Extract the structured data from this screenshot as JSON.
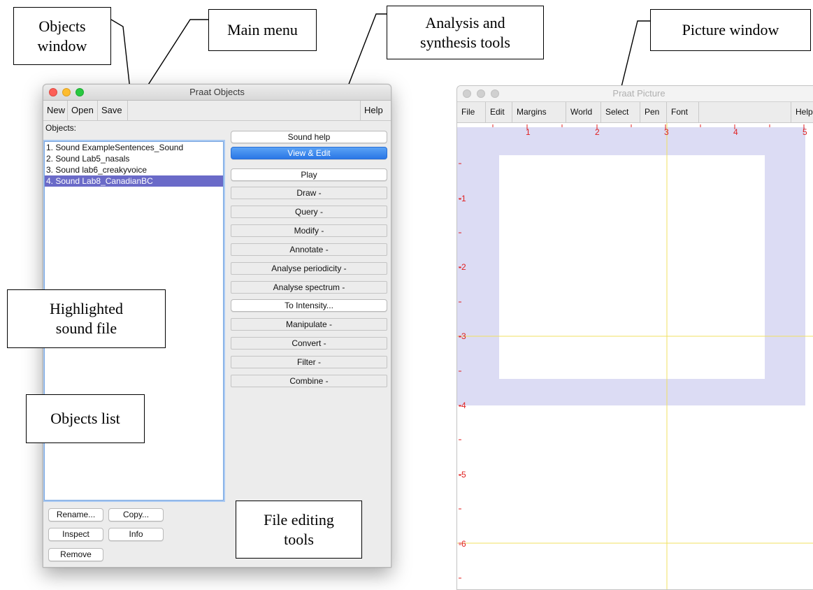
{
  "callouts": {
    "objects_window": "Objects\nwindow",
    "main_menu": "Main menu",
    "analysis_tools": "Analysis and\nsynthesis tools",
    "picture_window": "Picture window",
    "highlighted_sound": "Highlighted\nsound file",
    "objects_list": "Objects list",
    "file_editing": "File editing\ntools"
  },
  "objects_window": {
    "title": "Praat Objects",
    "menu": [
      "New",
      "Open",
      "Save"
    ],
    "help": "Help",
    "objects_label": "Objects:",
    "objects": [
      "1. Sound ExampleSentences_Sound",
      "2. Sound Lab5_nasals",
      "3. Sound lab6_creakyvoice",
      "4. Sound Lab8_CanadianBC"
    ],
    "selected_index": 3,
    "actions": [
      "Sound help",
      "View & Edit",
      "Play",
      "Draw -",
      "Query -",
      "Modify -",
      "Annotate -",
      "Analyse periodicity -",
      "Analyse spectrum -",
      "To Intensity...",
      "Manipulate -",
      "Convert -",
      "Filter -",
      "Combine -"
    ],
    "file_buttons": {
      "rename": "Rename...",
      "copy": "Copy...",
      "inspect": "Inspect",
      "info": "Info",
      "remove": "Remove"
    },
    "colors": {
      "selection": "#6a6ac8",
      "primary_button": "#2a77e6"
    }
  },
  "picture_window": {
    "title": "Praat Picture",
    "menu": [
      "File",
      "Edit",
      "Margins",
      "World",
      "Select",
      "Pen",
      "Font"
    ],
    "help": "Help",
    "ruler_top": [
      "1",
      "2",
      "3",
      "4",
      "5"
    ],
    "ruler_left": [
      "-1",
      "-2",
      "-3",
      "-4",
      "-5",
      "-6"
    ],
    "colors": {
      "selection_area": "#dcdcf4",
      "ruler": "#e02020",
      "guide": "#f0e060"
    }
  }
}
